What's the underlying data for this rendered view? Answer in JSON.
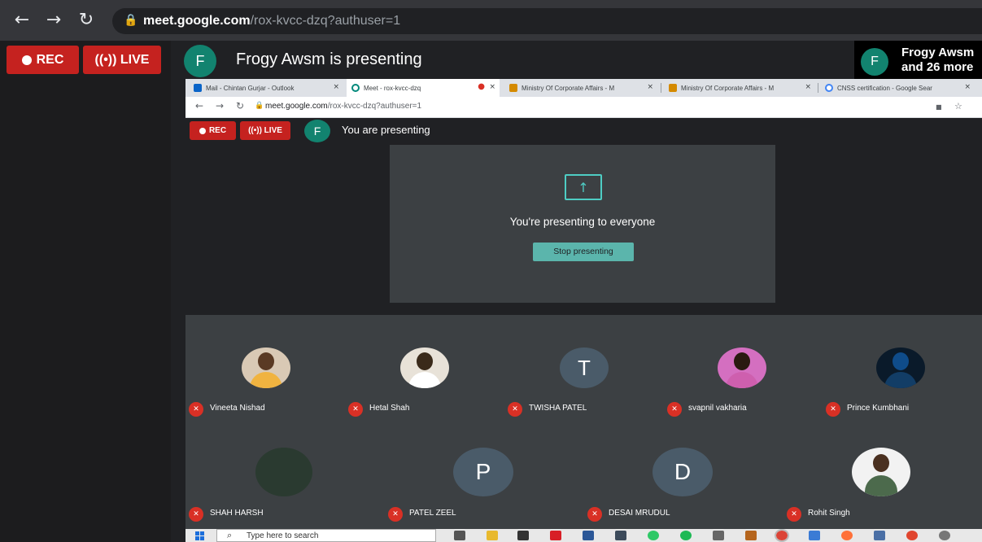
{
  "outer_browser": {
    "url_host": "meet.google.com",
    "url_path": "/rox-kvcc-dzq?authuser=1",
    "nav": {
      "back_icon": "←",
      "forward_icon": "→",
      "reload_icon": "↻",
      "lock_icon": "🔒"
    }
  },
  "outer_meet": {
    "rec_label": "REC",
    "live_label": "((•)) LIVE",
    "avatar_letter": "F",
    "presenting_text": "Frogy Awsm is presenting",
    "participants_card": {
      "avatar_letter": "F",
      "line1": "Frogy Awsm",
      "line2": "and 26 more"
    }
  },
  "inner_browser": {
    "tabs": [
      {
        "label": "Mail - Chintan Gurjar - Outlook",
        "close": "×",
        "icon_color": "#0a64c8"
      },
      {
        "label": "Meet - rox-kvcc-dzq",
        "close": "×",
        "icon_color": "#00897b",
        "recording_dot": "●"
      },
      {
        "label": "Ministry Of Corporate Affairs - M",
        "close": "×",
        "icon_color": "#d48a00"
      },
      {
        "label": "Ministry Of Corporate Affairs - M",
        "close": "×",
        "icon_color": "#d48a00"
      },
      {
        "label": "CNSS certification - Google Sear",
        "close": "×",
        "icon_color": "#4285f4"
      }
    ],
    "url_host": "meet.google.com",
    "url_path": "/rox-kvcc-dzq?authuser=1",
    "nav": {
      "back_icon": "←",
      "forward_icon": "→",
      "reload_icon": "↻",
      "lock_icon": "🔒",
      "camera_icon": "■",
      "star_icon": "☆"
    }
  },
  "inner_meet": {
    "rec_label": "REC",
    "live_label": "((•)) LIVE",
    "avatar_letter": "F",
    "presenting_text": "You are presenting",
    "present_icon": "↑",
    "present_message": "You're presenting to everyone",
    "stop_button": "Stop presenting"
  },
  "participants": [
    {
      "name": "Vineeta Nishad",
      "avatar": "photo"
    },
    {
      "name": "Hetal Shah",
      "avatar": "photo"
    },
    {
      "name": "TWISHA PATEL",
      "avatar": "T"
    },
    {
      "name": "svapnil vakharia",
      "avatar": "photo"
    },
    {
      "name": "Prince Kumbhani",
      "avatar": "photo"
    },
    {
      "name": "SHAH HARSH",
      "avatar": "photo"
    },
    {
      "name": "PATEL ZEEL",
      "avatar": "P"
    },
    {
      "name": "DESAI MRUDUL",
      "avatar": "D"
    },
    {
      "name": "Rohit Singh",
      "avatar": "photo"
    }
  ],
  "mic_muted_icon": "✕",
  "taskbar": {
    "search_placeholder": "Type here to search",
    "search_icon": "⌕",
    "apps": [
      "task-view",
      "file-explorer",
      "store",
      "netflix",
      "app-5",
      "app-6",
      "app-7",
      "spotify",
      "app-9",
      "app-10",
      "chrome",
      "app-12",
      "firefox",
      "app-14",
      "app-15",
      "app-16"
    ]
  },
  "colors": {
    "rec_red": "#c5221f",
    "avatar_teal": "#12836f",
    "meet_bg": "#202124",
    "tile_bg": "#3c4043",
    "accent_teal": "#5bb5ac"
  }
}
